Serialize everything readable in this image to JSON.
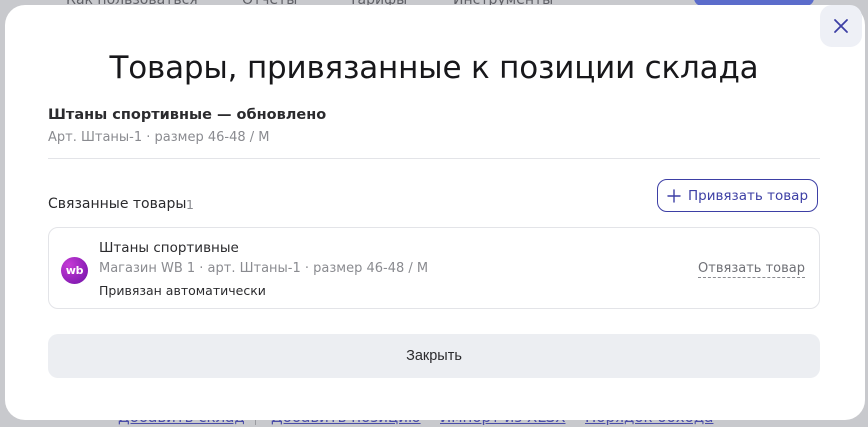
{
  "background": {
    "nav_items": [
      "Как пользоваться",
      "Отчеты",
      "Тарифы",
      "Инструменты"
    ],
    "bottom_links": [
      "Добавить склад",
      "Добавить позицию",
      "Импорт из XLSX",
      "Порядок обхода"
    ]
  },
  "modal": {
    "title": "Товары, привязанные к позиции склада",
    "item": {
      "name": "Штаны спортивные — обновлено",
      "details": "Арт. Штаны-1 · размер 46-48 / M"
    },
    "related": {
      "label": "Связанные товары",
      "count": "1",
      "add_button": "Привязать товар"
    },
    "linked_products": [
      {
        "logo": "wb",
        "name": "Штаны спортивные",
        "meta": "Магазин WB 1 · арт. Штаны-1 · размер 46-48 / M",
        "status": "Привязан автоматически",
        "unlink_label": "Отвязать товар"
      }
    ],
    "close_button": "Закрыть"
  },
  "icons": {
    "close": "close-icon",
    "add": "plus-icon"
  },
  "colors": {
    "accent": "#3d3fa5",
    "wb_brand": "#8a1eb5",
    "muted": "#8a8b90"
  }
}
